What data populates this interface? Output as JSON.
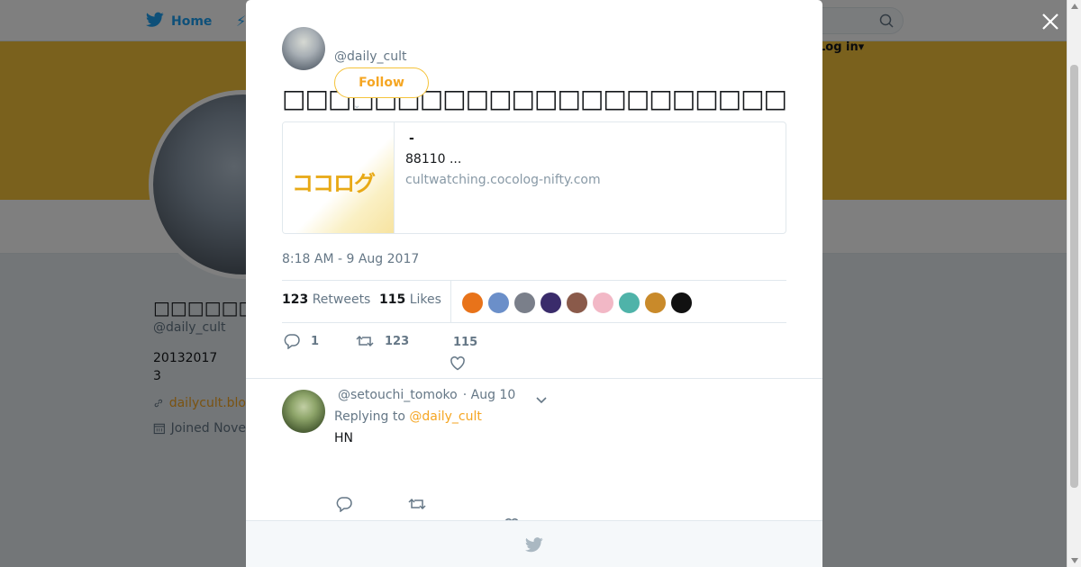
{
  "nav": {
    "home_label": "Home",
    "login_label": "Log in▾"
  },
  "profile_bg": {
    "name": "□□□□□□□□",
    "handle": "@daily_cult",
    "bio_line1": "20132017",
    "bio_line2": "3",
    "link": "dailycult.blo",
    "joined": "Joined Nove"
  },
  "tweet": {
    "author_handle": "@daily_cult",
    "follow_label": "Follow",
    "text": "□□□□□□□□□□□□□□□□□□□□□□□□□□□□□□",
    "card": {
      "logo": "ココログ",
      "title": "-",
      "description": "88110 ...",
      "domain": "cultwatching.cocolog-nifty.com"
    },
    "timestamp": "8:18 AM - 9 Aug 2017",
    "retweets_count": "123",
    "retweets_label": "Retweets",
    "likes_count": "115",
    "likes_label": "Likes",
    "action_reply_count": "1",
    "action_retweet_count": "123",
    "action_like_count": "115",
    "liker_colors": [
      "#e8731a",
      "#6b8fc9",
      "#7a7f8a",
      "#3a2c6b",
      "#8a5a4a",
      "#f2b8c6",
      "#4fb3a9",
      "#c98a2a",
      "#111111"
    ]
  },
  "reply": {
    "handle": "@setouchi_tomoko",
    "time": "· Aug 10",
    "replying_prefix": "Replying to",
    "replying_to": "@daily_cult",
    "text": "HN"
  },
  "colors": {
    "accent": "#f5a623",
    "banner": "#f5c33a",
    "twitter_blue": "#1da1f2"
  }
}
